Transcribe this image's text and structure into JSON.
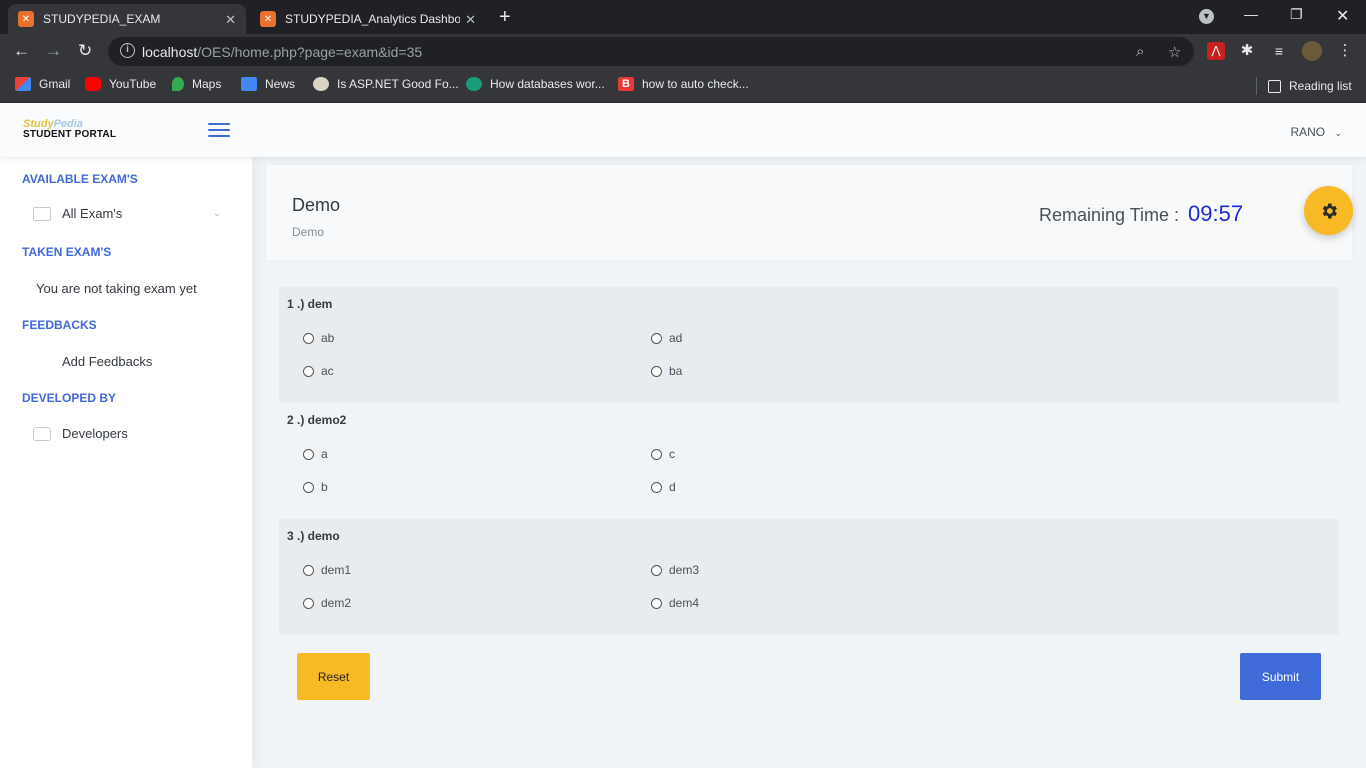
{
  "browser": {
    "tabs": [
      {
        "title": "STUDYPEDIA_EXAM",
        "active": true
      },
      {
        "title": "STUDYPEDIA_Analytics Dashboar",
        "active": false
      }
    ],
    "url_host": "localhost",
    "url_path": "/OES/home.php?page=exam&id=35",
    "bookmarks": [
      "Gmail",
      "YouTube",
      "Maps",
      "News",
      "Is ASP.NET Good Fo...",
      "How databases wor...",
      "how to auto check..."
    ],
    "reading_list": "Reading list"
  },
  "app": {
    "logo_top": "Study",
    "logo_top_accent": "Pedia",
    "logo_bottom": "STUDENT PORTAL",
    "user_name": "RANO"
  },
  "sidebar": {
    "available_heading": "AVAILABLE EXAM'S",
    "all_exams": "All Exam's",
    "taken_heading": "TAKEN EXAM'S",
    "taken_text": "You are not taking exam yet",
    "feedback_heading": "FEEDBACKS",
    "add_feedback": "Add Feedbacks",
    "developed_heading": "DEVELOPED BY",
    "developers": "Developers"
  },
  "exam": {
    "title": "Demo",
    "subtitle": "Demo",
    "remaining_label": "Remaining Time :",
    "remaining_value": "09:57",
    "questions": [
      {
        "label": "1 .) dem",
        "options": [
          "ab",
          "ad",
          "ac",
          "ba"
        ]
      },
      {
        "label": "2 .) demo2",
        "options": [
          "a",
          "c",
          "b",
          "d"
        ]
      },
      {
        "label": "3 .) demo",
        "options": [
          "dem1",
          "dem3",
          "dem2",
          "dem4"
        ]
      }
    ],
    "reset_label": "Reset",
    "submit_label": "Submit"
  }
}
